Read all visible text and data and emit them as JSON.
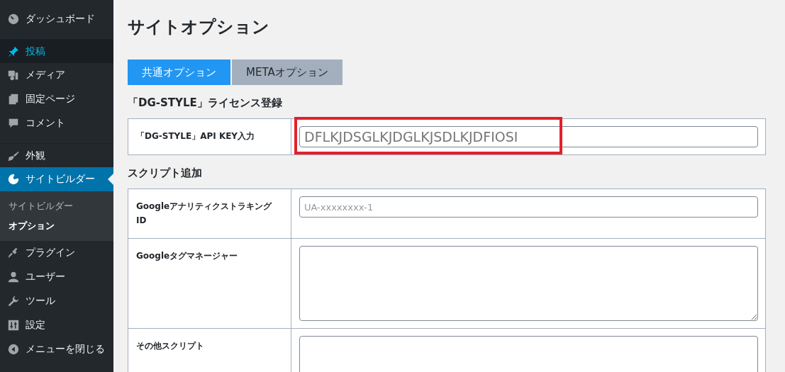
{
  "sidebar": {
    "items": [
      {
        "label": "ダッシュボード",
        "selected": false,
        "hovered": false,
        "separator_before": false
      },
      {
        "label": "投稿",
        "selected": false,
        "hovered": true,
        "separator_before": true
      },
      {
        "label": "メディア",
        "selected": false,
        "hovered": false,
        "separator_before": false
      },
      {
        "label": "固定ページ",
        "selected": false,
        "hovered": false,
        "separator_before": false
      },
      {
        "label": "コメント",
        "selected": false,
        "hovered": false,
        "separator_before": false
      },
      {
        "label": "外観",
        "selected": false,
        "hovered": false,
        "separator_before": true
      },
      {
        "label": "サイトビルダー",
        "selected": true,
        "hovered": false,
        "separator_before": false,
        "children": [
          {
            "label": "サイトビルダー",
            "selected": false
          },
          {
            "label": "オプション",
            "selected": true
          }
        ]
      },
      {
        "label": "プラグイン",
        "selected": false,
        "hovered": false,
        "separator_before": false
      },
      {
        "label": "ユーザー",
        "selected": false,
        "hovered": false,
        "separator_before": false
      },
      {
        "label": "ツール",
        "selected": false,
        "hovered": false,
        "separator_before": false
      },
      {
        "label": "設定",
        "selected": false,
        "hovered": false,
        "separator_before": false
      },
      {
        "label": "メニューを閉じる",
        "selected": false,
        "hovered": false,
        "separator_before": false
      }
    ]
  },
  "page_title": "サイトオプション",
  "tabs": [
    {
      "label": "共通オプション",
      "selected": true
    },
    {
      "label": "METAオプション",
      "selected": false
    }
  ],
  "sections": [
    {
      "heading": "「DG-STYLE」ライセンス登録",
      "rows": [
        {
          "label": "「DG-STYLE」API KEY入力",
          "kind": "input",
          "value": "DFLKJDSGLKJDGLKJSDLKJDFIOSI",
          "highlighted": true
        }
      ]
    },
    {
      "heading": "スクリプト追加",
      "rows": [
        {
          "label": "Googleアナリティクストラキング ID",
          "kind": "input",
          "placeholder": "UA-xxxxxxxx-1",
          "highlighted": false
        },
        {
          "label": "Googleタグマネージャー",
          "kind": "textarea",
          "highlighted": false
        },
        {
          "label": "その他スクリプト",
          "kind": "textarea-cut",
          "highlighted": false
        }
      ]
    }
  ]
}
